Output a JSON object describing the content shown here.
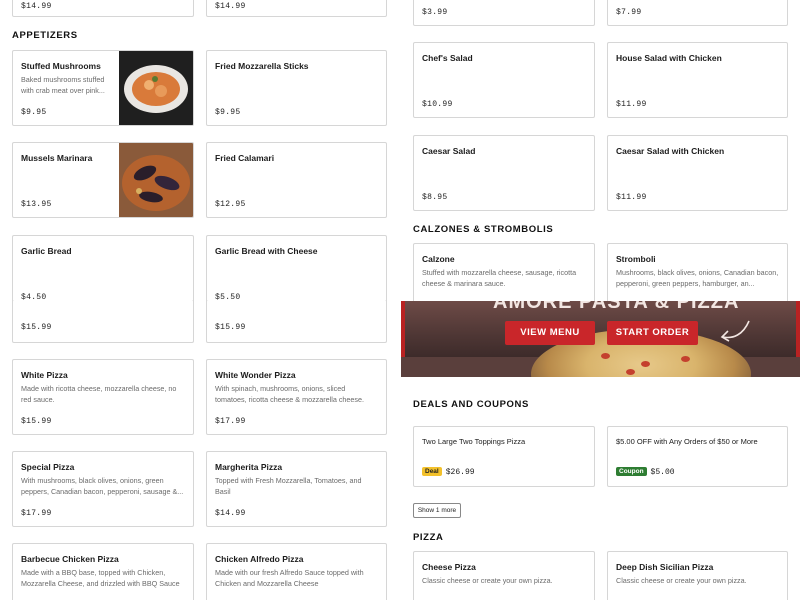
{
  "left": {
    "top_prices": [
      "$14.99",
      "$14.99"
    ],
    "appetizers_heading": "APPETIZERS",
    "appetizers": [
      {
        "title": "Stuffed Mushrooms",
        "desc": "Baked mushrooms stuffed with crab meat over pink...",
        "price": "$9.95"
      },
      {
        "title": "Fried Mozzarella Sticks",
        "desc": "",
        "price": "$9.95"
      },
      {
        "title": "Mussels Marinara",
        "desc": "",
        "price": "$13.95"
      },
      {
        "title": "Fried Calamari",
        "desc": "",
        "price": "$12.95"
      },
      {
        "title": "Garlic Bread",
        "desc": "",
        "price": "$4.50"
      },
      {
        "title": "Garlic Bread with Cheese",
        "desc": "",
        "price": "$5.50"
      }
    ],
    "mid_prices": [
      "$15.99",
      "$15.99"
    ],
    "pizzas": [
      {
        "title": "White Pizza",
        "desc": "Made with ricotta cheese, mozzarella cheese, no red sauce.",
        "price": "$15.99"
      },
      {
        "title": "White Wonder Pizza",
        "desc": "With spinach, mushrooms, onions, sliced tomatoes, ricotta cheese & mozzarella cheese.",
        "price": "$17.99"
      },
      {
        "title": "Special Pizza",
        "desc": "With mushrooms, black olives, onions, green peppers, Canadian bacon, pepperoni, sausage &...",
        "price": "$17.99"
      },
      {
        "title": "Margherita Pizza",
        "desc": "Topped with Fresh Mozzarella, Tomatoes, and Basil",
        "price": "$14.99"
      },
      {
        "title": "Barbecue Chicken Pizza",
        "desc": "Made with a BBQ base, topped with Chicken, Mozzarella Cheese, and drizzled with BBQ Sauce",
        "price": ""
      },
      {
        "title": "Chicken Alfredo Pizza",
        "desc": "Made with our fresh Alfredo Sauce topped with Chicken and Mozzarella Cheese",
        "price": ""
      }
    ]
  },
  "right": {
    "top_prices": [
      "$3.99",
      "$7.99"
    ],
    "salads": [
      {
        "title": "Chef's Salad",
        "price": "$10.99"
      },
      {
        "title": "House Salad with Chicken",
        "price": "$11.99"
      },
      {
        "title": "Caesar Salad",
        "price": "$8.95"
      },
      {
        "title": "Caesar Salad with Chicken",
        "price": "$11.99"
      }
    ],
    "calzones_heading": "CALZONES & STROMBOLIS",
    "calzones": [
      {
        "title": "Calzone",
        "desc": "Stuffed with mozzarella cheese, sausage, ricotta cheese & marinara sauce."
      },
      {
        "title": "Stromboli",
        "desc": "Mushrooms, black olives, onions, Canadian bacon, pepperoni, green peppers, hamburger, an..."
      }
    ],
    "promo": {
      "headline": "AMORE PASTA & PIZZA",
      "view_menu": "VIEW MENU",
      "start_order": "START ORDER"
    },
    "deals_heading": "DEALS AND COUPONS",
    "deals": [
      {
        "title": "Two Large Two Toppings Pizza",
        "tag": "Deal",
        "price": "$26.99",
        "tag_color": "#f3c12b"
      },
      {
        "title": "$5.00 OFF with Any Orders of $50 or More",
        "tag": "Coupon",
        "price": "$5.00",
        "tag_color": "#2e7d32"
      }
    ],
    "show_more": "Show 1 more",
    "pizza_heading": "PIZZA",
    "pizza": [
      {
        "title": "Cheese Pizza",
        "desc": "Classic cheese or create your own pizza."
      },
      {
        "title": "Deep Dish Sicilian Pizza",
        "desc": "Classic cheese or create your own pizza."
      }
    ]
  },
  "colors": {
    "accent": "#c9262a",
    "border": "#d6d6d6"
  }
}
